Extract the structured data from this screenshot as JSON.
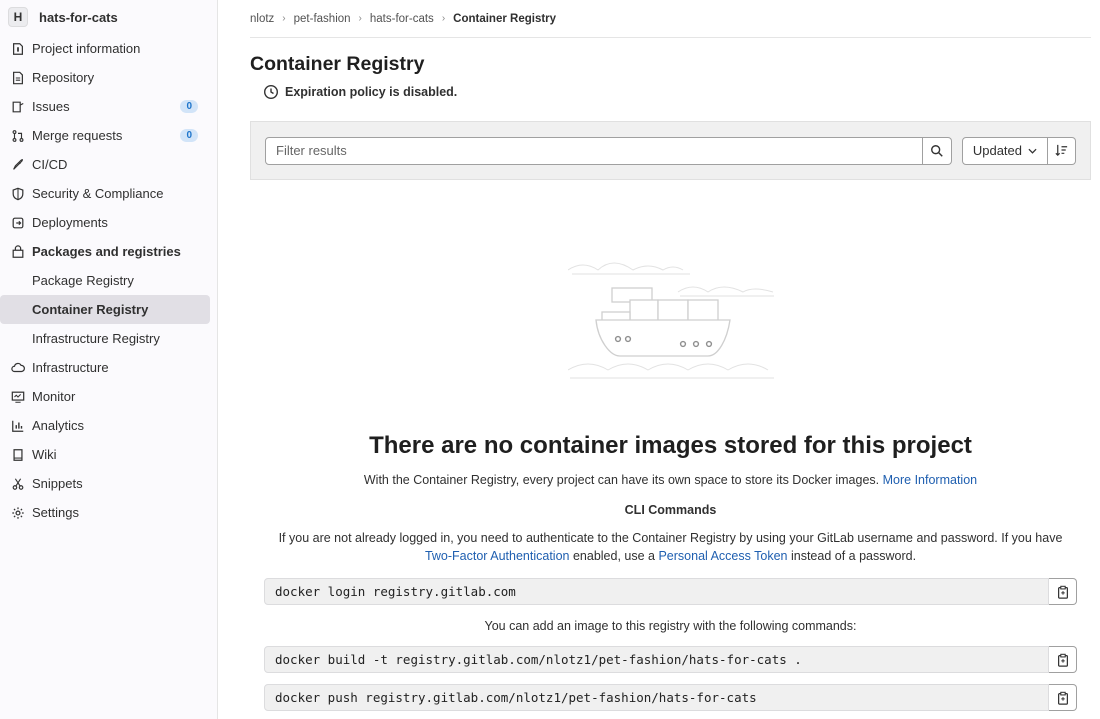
{
  "sidebar": {
    "avatar_letter": "H",
    "project_name": "hats-for-cats",
    "items": [
      {
        "label": "Project information",
        "icon": "info-icon"
      },
      {
        "label": "Repository",
        "icon": "doc-icon"
      },
      {
        "label": "Issues",
        "icon": "issues-icon",
        "badge": "0"
      },
      {
        "label": "Merge requests",
        "icon": "merge-icon",
        "badge": "0"
      },
      {
        "label": "CI/CD",
        "icon": "rocket-icon"
      },
      {
        "label": "Security & Compliance",
        "icon": "shield-icon"
      },
      {
        "label": "Deployments",
        "icon": "deployments-icon"
      },
      {
        "label": "Packages and registries",
        "icon": "package-icon"
      }
    ],
    "subitems": [
      {
        "label": "Package Registry"
      },
      {
        "label": "Container Registry"
      },
      {
        "label": "Infrastructure Registry"
      }
    ],
    "items2": [
      {
        "label": "Infrastructure",
        "icon": "cloud-icon"
      },
      {
        "label": "Monitor",
        "icon": "monitor-icon"
      },
      {
        "label": "Analytics",
        "icon": "chart-icon"
      },
      {
        "label": "Wiki",
        "icon": "book-icon"
      },
      {
        "label": "Snippets",
        "icon": "scissors-icon"
      },
      {
        "label": "Settings",
        "icon": "gear-icon"
      }
    ]
  },
  "breadcrumb": [
    "nlotz",
    "pet-fashion",
    "hats-for-cats",
    "Container Registry"
  ],
  "page": {
    "title": "Container Registry",
    "expiration": "Expiration policy is disabled."
  },
  "filter": {
    "placeholder": "Filter results",
    "sort_label": "Updated"
  },
  "empty": {
    "title": "There are no container images stored for this project",
    "desc": "With the Container Registry, every project can have its own space to store its Docker images.",
    "more_link": "More Information",
    "cli_title": "CLI Commands",
    "auth_1": "If you are not already logged in, you need to authenticate to the Container Registry by using your GitLab username and password. If you have",
    "tfa_link": "Two-Factor Authentication",
    "auth_2": "enabled, use a",
    "pat_link": "Personal Access Token",
    "auth_3": "instead of a password.",
    "login_cmd": "docker login registry.gitlab.com",
    "add_text": "You can add an image to this registry with the following commands:",
    "build_cmd": "docker build -t registry.gitlab.com/nlotz1/pet-fashion/hats-for-cats .",
    "push_cmd": "docker push registry.gitlab.com/nlotz1/pet-fashion/hats-for-cats"
  }
}
